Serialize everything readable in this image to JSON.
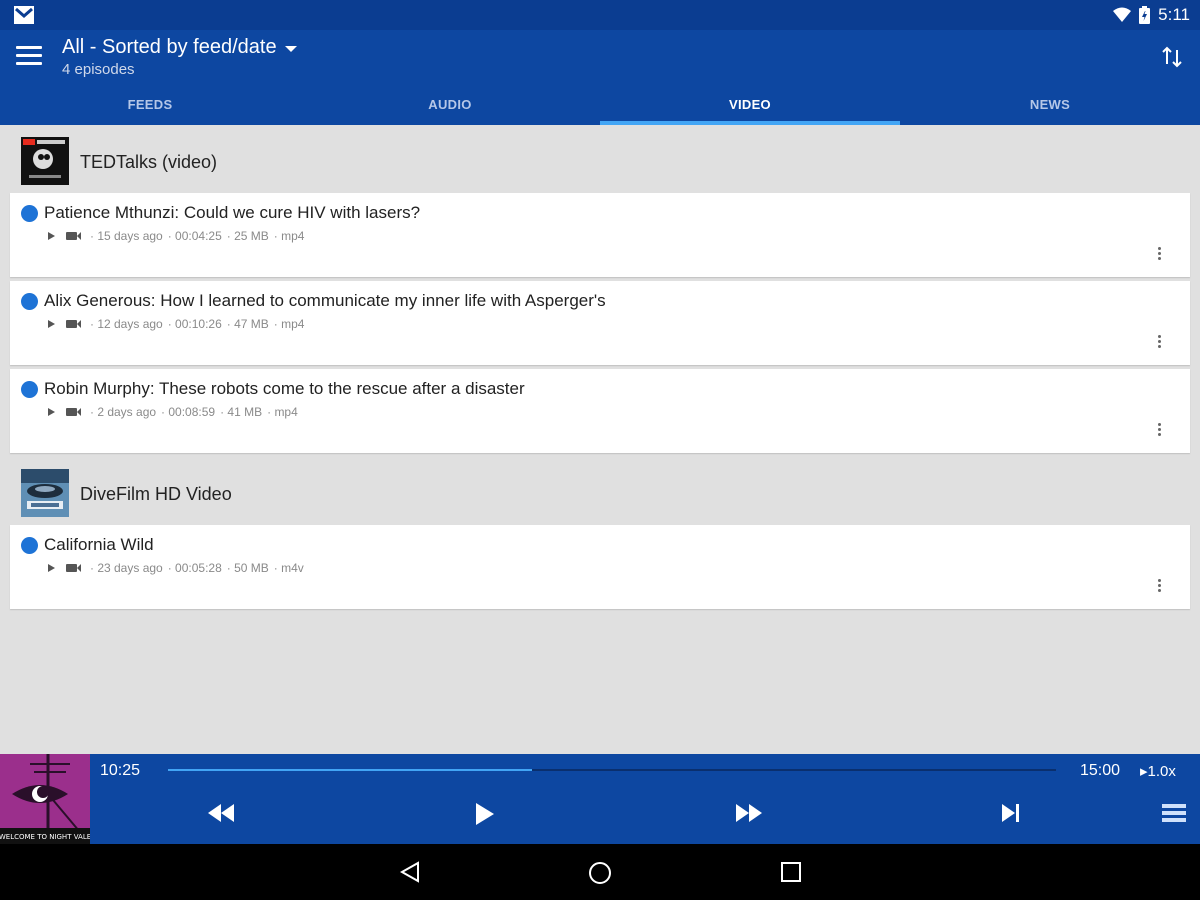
{
  "status_bar": {
    "time": "5:11"
  },
  "toolbar": {
    "title": "All - Sorted by feed/date",
    "subtitle": "4 episodes"
  },
  "tabs": [
    {
      "label": "FEEDS",
      "active": false
    },
    {
      "label": "AUDIO",
      "active": false
    },
    {
      "label": "VIDEO",
      "active": true
    },
    {
      "label": "NEWS",
      "active": false
    }
  ],
  "feeds": [
    {
      "title": "TEDTalks (video)",
      "episodes": [
        {
          "title": "Patience Mthunzi: Could we cure HIV with lasers?",
          "age": "· 15 days ago",
          "duration": "· 00:04:25",
          "size": "· 25 MB",
          "format": "· mp4"
        },
        {
          "title": "Alix Generous: How I learned to communicate my inner life with Asperger's",
          "age": "· 12 days ago",
          "duration": "· 00:10:26",
          "size": "· 47 MB",
          "format": "· mp4"
        },
        {
          "title": "Robin Murphy: These robots come to the rescue after a disaster",
          "age": "· 2 days ago",
          "duration": "· 00:08:59",
          "size": "· 41 MB",
          "format": "· mp4"
        }
      ]
    },
    {
      "title": "DiveFilm HD Video",
      "episodes": [
        {
          "title": "California Wild",
          "age": "· 23 days ago",
          "duration": "· 00:05:28",
          "size": "· 50 MB",
          "format": "· m4v"
        }
      ]
    }
  ],
  "player": {
    "current_time": "10:25",
    "total_time": "15:00",
    "speed": "1.0x",
    "progress": 0.41,
    "cover_text": "WELCOME TO NIGHT VALE"
  },
  "colors": {
    "primary": "#0d47a1",
    "accent": "#42a5f5",
    "unplayed_dot": "#1e73d6"
  }
}
